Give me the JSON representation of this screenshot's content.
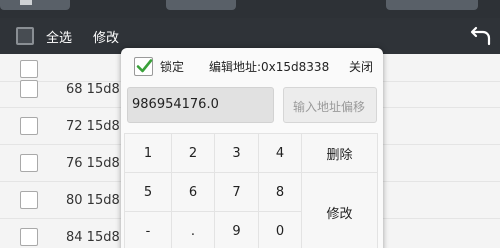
{
  "toolbar": {
    "select_all_label": "全选",
    "modify_label": "修改"
  },
  "list": {
    "rows": [
      {
        "text": ""
      },
      {
        "text": "68  15d8"
      },
      {
        "text": "72  15d8"
      },
      {
        "text": "76  15d8"
      },
      {
        "text": "80  15d8"
      },
      {
        "text": "84  15d8"
      }
    ]
  },
  "dialog": {
    "lock_label": "锁定",
    "lock_checked": true,
    "address_label": "编辑地址:0x15d8338",
    "close_label": "关闭",
    "value": "986954176.0",
    "offset_placeholder": "输入地址偏移",
    "keys": {
      "k1": "1",
      "k2": "2",
      "k3": "3",
      "k4": "4",
      "k5": "5",
      "k6": "6",
      "k7": "7",
      "k8": "8",
      "minus": "-",
      "dot": ".",
      "k9": "9",
      "k0": "0",
      "delete": "删除",
      "modify": "修改"
    }
  },
  "colors": {
    "toolbar_bg": "#2f3338",
    "check_green": "#3aa13a",
    "dialog_bg": "#fafafa"
  }
}
